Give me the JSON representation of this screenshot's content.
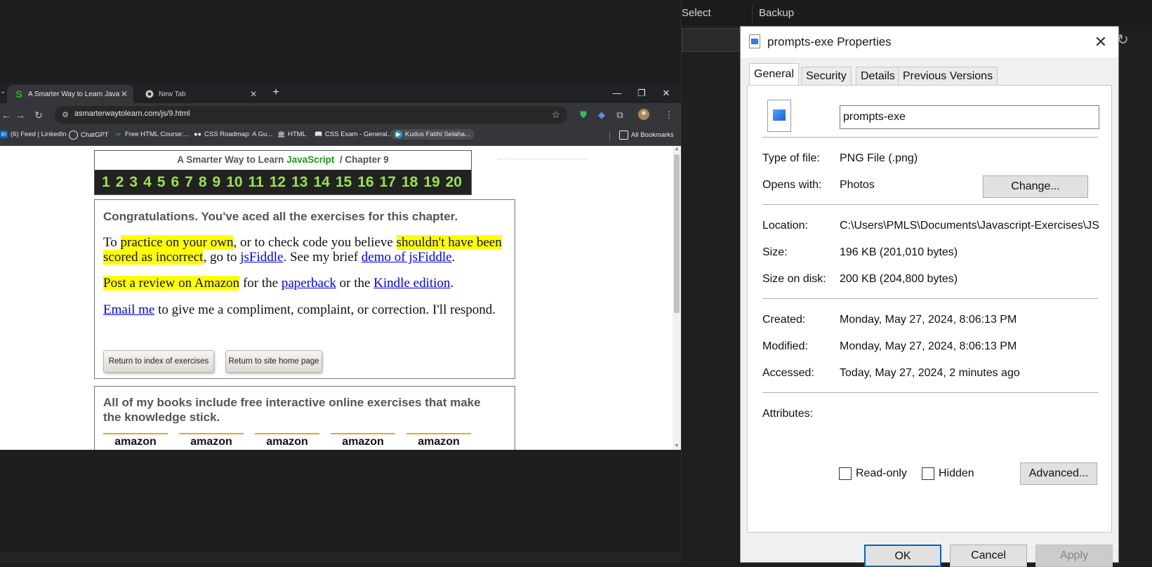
{
  "background_app": {
    "tabs": [
      "Select",
      "Backup"
    ]
  },
  "browser": {
    "tabs": [
      {
        "title": "A Smarter Way to Learn JavaScr",
        "favicon": "S",
        "active": true
      },
      {
        "title": "New Tab",
        "favicon": "chrome-icon",
        "active": false
      }
    ],
    "url": "asmarterwaytolearn.com/js/9.html",
    "bookmarks": [
      "(6) Feed | LinkedIn",
      "ChatGPT",
      "Free HTML Course:...",
      "CSS Roadmap: A Gu...",
      "HTML",
      "CSS Exam - General...",
      "Kudus Fatihi Selaha...",
      "All Bookmarks"
    ]
  },
  "page": {
    "chapter_prefix": "A Smarter Way to Learn",
    "chapter_js": "JavaScript",
    "chapter_suffix": "/  Chapter 9",
    "chapter_numbers": [
      "1",
      "2",
      "3",
      "4",
      "5",
      "6",
      "7",
      "8",
      "9",
      "10",
      "11",
      "12",
      "13",
      "14",
      "15",
      "16",
      "17",
      "18",
      "19",
      "20"
    ],
    "congrats": "Congratulations. You've aced all the exercises for this chapter.",
    "p1": {
      "t1": "To ",
      "h1": "practice on your own",
      "t2": ", or to check code you believe ",
      "h2": "shouldn't have been scored as incorrect",
      "t3": ", go to ",
      "l1": "jsFiddle",
      "t4": ". See my brief ",
      "l2": "demo of jsFiddle",
      "t5": "."
    },
    "p2": {
      "h1": "Post a review on Amazon",
      "t1": " for the ",
      "l1": "paperback",
      "t2": " or the ",
      "l2": "Kindle edition",
      "t3": "."
    },
    "p3": {
      "l1": "Email me",
      "t1": " to give me a compliment, complaint, or correction. I'll respond."
    },
    "btn_index": "Return to index of exercises",
    "btn_home": "Return to site home page",
    "books_head": "All of my books include free interactive online exercises that make the knowledge stick.",
    "amazon_label": "amazon"
  },
  "dialog": {
    "title": "prompts-exe Properties",
    "tabs": [
      "General",
      "Security",
      "Details",
      "Previous Versions"
    ],
    "filename": "prompts-exe",
    "rows": {
      "type_label": "Type of file:",
      "type_value": "PNG File (.png)",
      "opens_label": "Opens with:",
      "opens_value": "Photos",
      "change_btn": "Change...",
      "location_label": "Location:",
      "location_value": "C:\\Users\\PMLS\\Documents\\Javascript-Exercises\\JS-",
      "size_label": "Size:",
      "size_value": "196 KB (201,010 bytes)",
      "disk_label": "Size on disk:",
      "disk_value": "200 KB (204,800 bytes)",
      "created_label": "Created:",
      "created_value": "Monday, May 27, 2024, 8:06:13 PM",
      "modified_label": "Modified:",
      "modified_value": "Monday, May 27, 2024, 8:06:13 PM",
      "accessed_label": "Accessed:",
      "accessed_value": "Today, May 27, 2024, 2 minutes ago",
      "attributes_label": "Attributes:",
      "readonly_label": "Read-only",
      "hidden_label": "Hidden",
      "advanced_btn": "Advanced..."
    },
    "ok": "OK",
    "cancel": "Cancel",
    "apply": "Apply"
  },
  "colors": {
    "highlight": "#ffff00",
    "link": "#0000ee",
    "chapter_num": "#9be34a",
    "js_green": "#1a9a1a"
  }
}
